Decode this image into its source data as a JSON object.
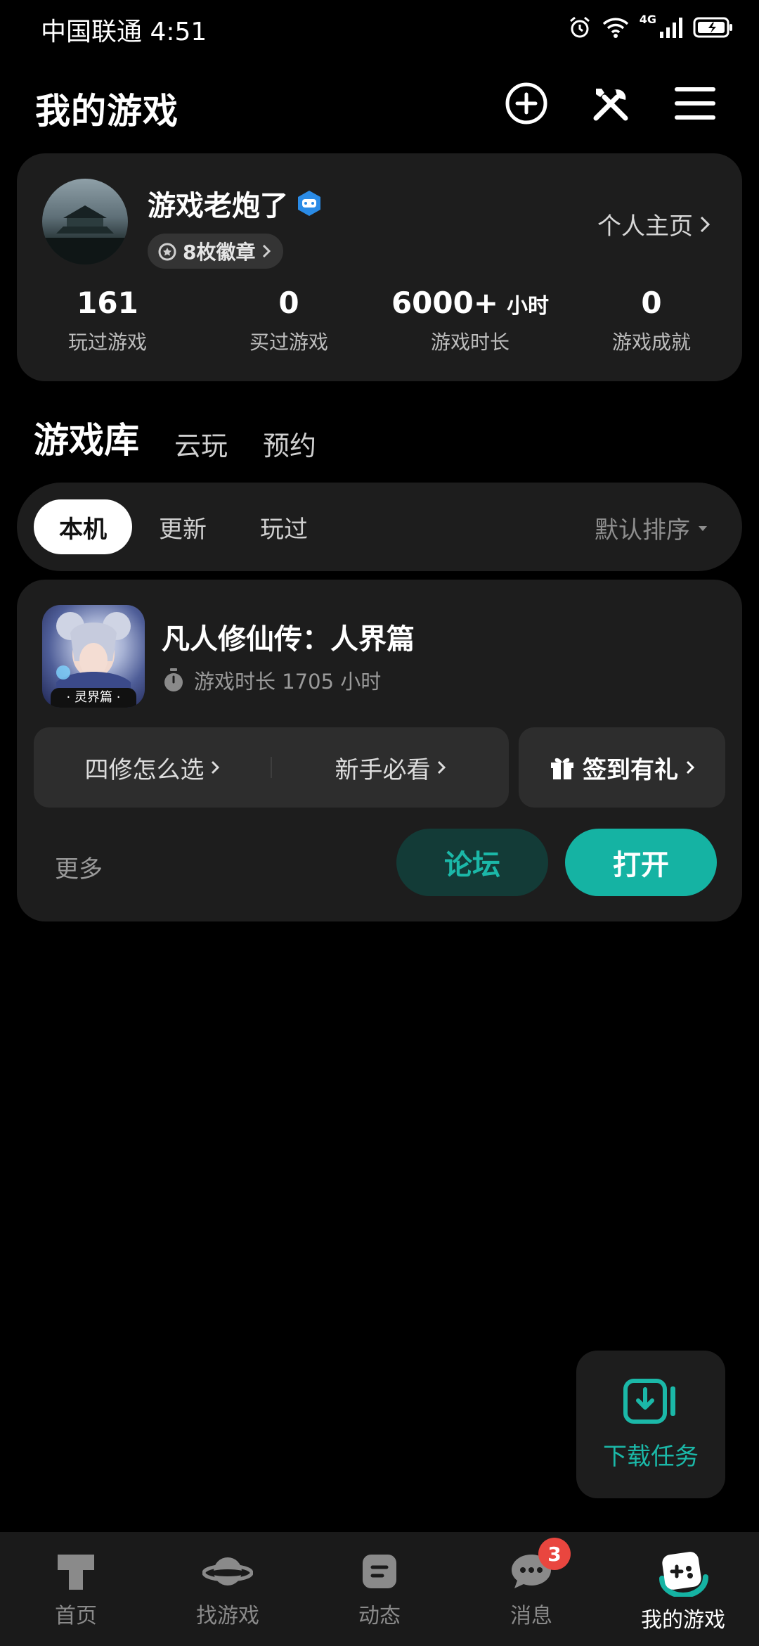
{
  "status_bar": {
    "carrier_time": "中国联通 4:51",
    "network": "4G"
  },
  "header": {
    "title": "我的游戏",
    "icons": [
      "add-circle-icon",
      "tools-icon",
      "menu-icon"
    ]
  },
  "profile": {
    "username": "游戏老炮了",
    "badge_count_label": "8枚徽章",
    "homepage_label": "个人主页",
    "stats": [
      {
        "value": "161",
        "unit": "",
        "label": "玩过游戏"
      },
      {
        "value": "0",
        "unit": "",
        "label": "买过游戏"
      },
      {
        "value": "6000+",
        "unit": "小时",
        "label": "游戏时长"
      },
      {
        "value": "0",
        "unit": "",
        "label": "游戏成就"
      }
    ]
  },
  "main_tabs": [
    {
      "label": "游戏库",
      "active": true
    },
    {
      "label": "云玩"
    },
    {
      "label": "预约"
    }
  ],
  "filters": {
    "chips": [
      {
        "label": "本机",
        "active": true
      },
      {
        "label": "更新"
      },
      {
        "label": "玩过"
      }
    ],
    "sort_label": "默认排序"
  },
  "game": {
    "name": "凡人修仙传：人界篇",
    "icon_tag": "· 灵界篇 ·",
    "playtime_label": "游戏时长 1705 小时",
    "quick_links": [
      "四修怎么选",
      "新手必看"
    ],
    "checkin_label": "签到有礼",
    "more_label": "更多",
    "forum_label": "论坛",
    "open_label": "打开"
  },
  "download_task": {
    "label": "下载任务"
  },
  "tabbar": {
    "items": [
      {
        "label": "首页",
        "icon": "home-icon"
      },
      {
        "label": "找游戏",
        "icon": "planet-icon"
      },
      {
        "label": "动态",
        "icon": "feed-icon"
      },
      {
        "label": "消息",
        "icon": "message-icon",
        "badge": "3"
      },
      {
        "label": "我的游戏",
        "icon": "gamepad-icon",
        "active": true
      }
    ]
  },
  "colors": {
    "accent": "#15b3a3",
    "card": "#1d1d1d",
    "badge": "#e9463f"
  }
}
